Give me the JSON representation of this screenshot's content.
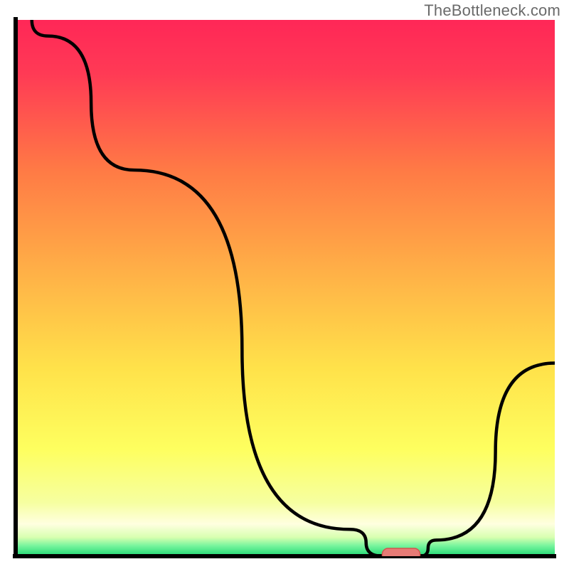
{
  "watermark": "TheBottleneck.com",
  "chart_data": {
    "type": "line",
    "title": "",
    "xlabel": "",
    "ylabel": "",
    "xlim": [
      0,
      100
    ],
    "ylim": [
      0,
      100
    ],
    "x": [
      0,
      6,
      22,
      62,
      68,
      75,
      78,
      100
    ],
    "values": [
      103,
      97,
      72,
      5,
      0,
      0,
      3,
      36
    ],
    "marker": {
      "x_start": 68,
      "x_end": 75,
      "y": 0
    },
    "colors": {
      "gradient_top": "#ff2757",
      "gradient_mid1": "#ff8b3d",
      "gradient_mid2": "#ffe24a",
      "gradient_mid3": "#f8ff7a",
      "gradient_bottom_band": "#ffffc0",
      "gradient_green": "#2be07a",
      "axis": "#000000",
      "curve": "#000000",
      "marker_fill": "#e77b76",
      "marker_stroke": "#d2554f"
    }
  }
}
